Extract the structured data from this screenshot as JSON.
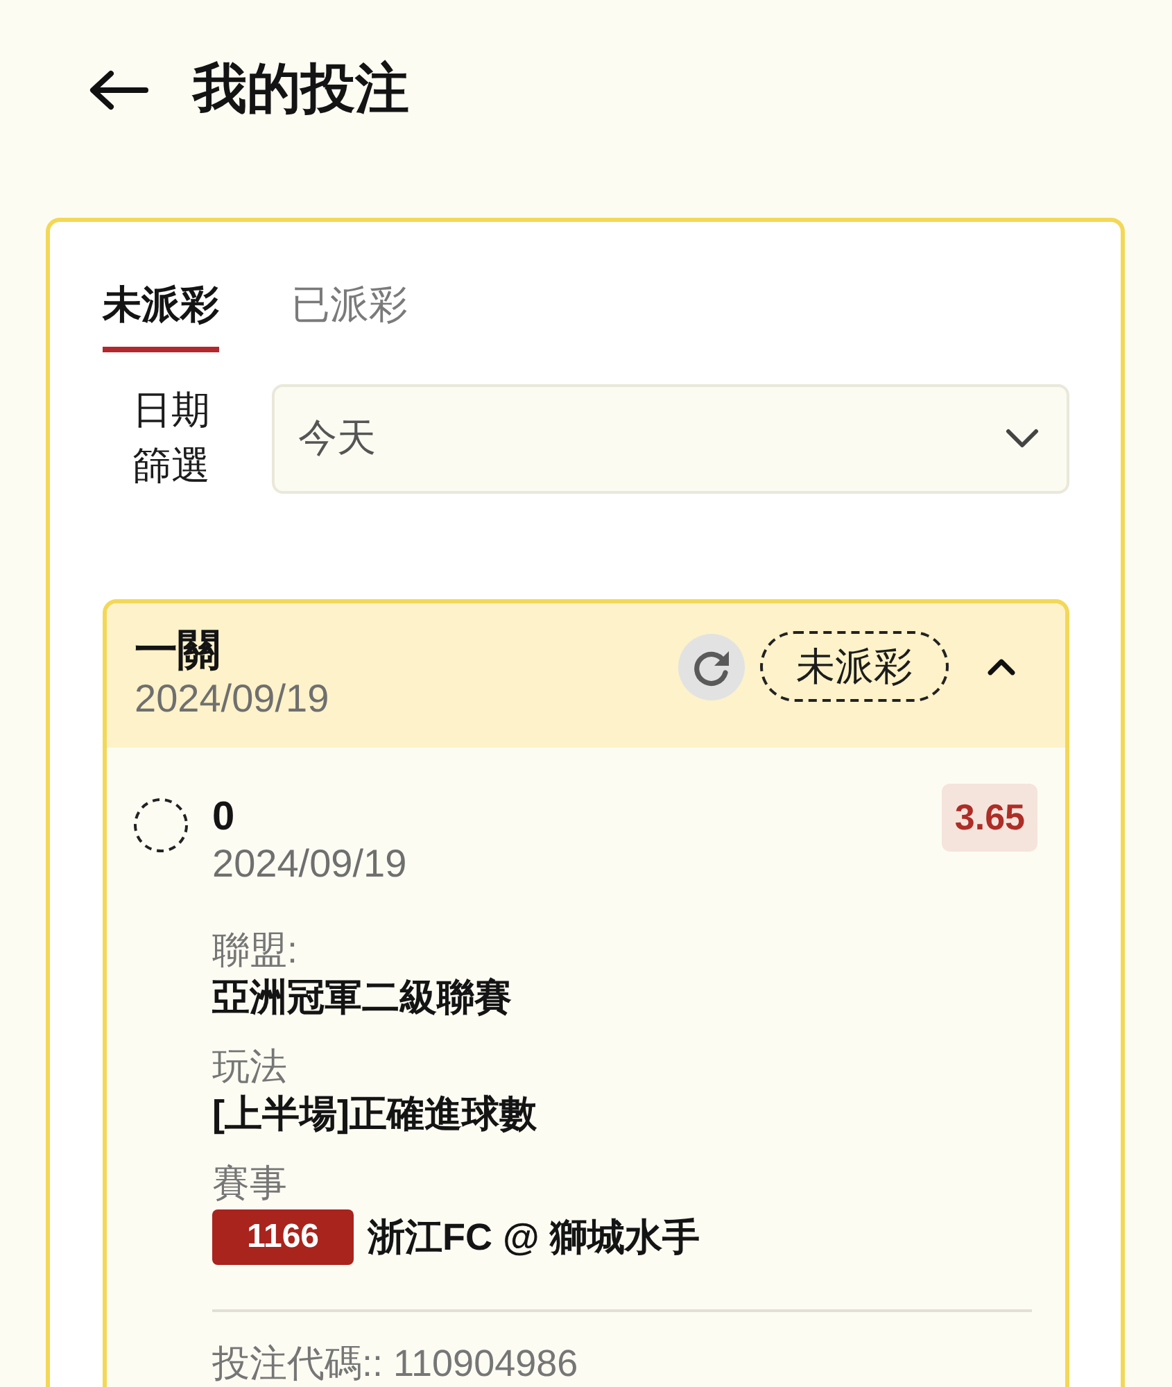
{
  "header": {
    "title": "我的投注"
  },
  "tabs": [
    {
      "label": "未派彩",
      "selected": true
    },
    {
      "label": "已派彩",
      "selected": false
    }
  ],
  "date_filter": {
    "label": "日期篩選",
    "value": "今天"
  },
  "bets": [
    {
      "type": "一關",
      "date": "2024/09/19",
      "status": "未派彩",
      "expanded": true,
      "selections": [
        {
          "selection": "0",
          "date": "2024/09/19",
          "odds": "3.65",
          "league_label": "聯盟:",
          "league": "亞洲冠軍二級聯賽",
          "market_label": "玩法",
          "market": "[上半場]正確進球數",
          "event_label": "賽事",
          "event_code": "1166",
          "event": "浙江FC @ 獅城水手"
        }
      ],
      "bet_code": "投注代碼:: 110904986"
    }
  ]
}
